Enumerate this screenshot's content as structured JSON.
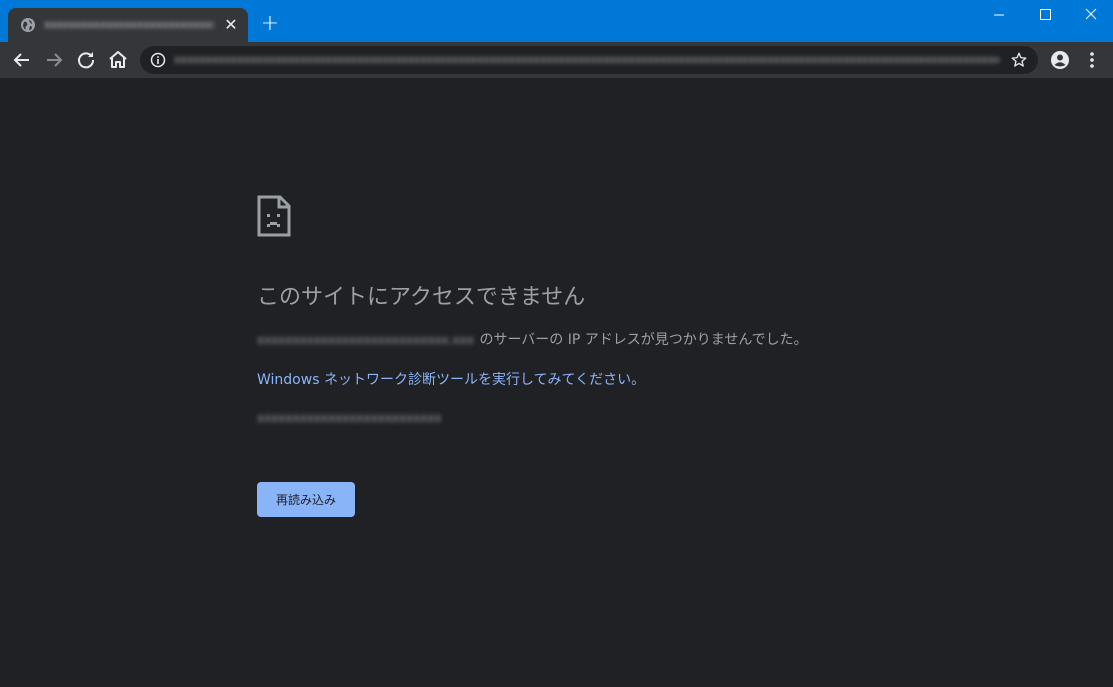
{
  "browser": {
    "tab": {
      "title": "xxxxxxxxxxxxxxxxxxxxxxxxxxxx.xxx",
      "favicon": "globe-icon"
    },
    "omnibox": {
      "url": "xxxxxxxxxxxxxxxxxxxxxxxxxxxxxxxxxxxxxxxxxxxxxxxxxxxxxxxxxxxxxxxxxxxxxxxxxxxxxxxxxxxxxxxxxxxxxxxxxxxxxxxxxxxxxxxxxxxxxxxxxxxxxxxxxxxxxx",
      "info_icon": "info-icon",
      "bookmark_icon": "star-icon"
    },
    "titlebar_color": "#0078d7",
    "toolbar_color": "#35363a"
  },
  "error_page": {
    "icon": "sad-page-icon",
    "title": "このサイトにアクセスできません",
    "server_host": "xxxxxxxxxxxxxxxxxxxxxxxxxxx.xxx",
    "server_message": " のサーバーの IP アドレスが見つかりませんでした。",
    "diagnostic_link": "Windows ネットワーク診断ツールを実行してみてください。",
    "error_code": "xxxxxxxxxxxxxxxxxxxxxxxxxx",
    "reload_label": "再読み込み",
    "background_color": "#202124",
    "link_color": "#8ab4f8"
  }
}
